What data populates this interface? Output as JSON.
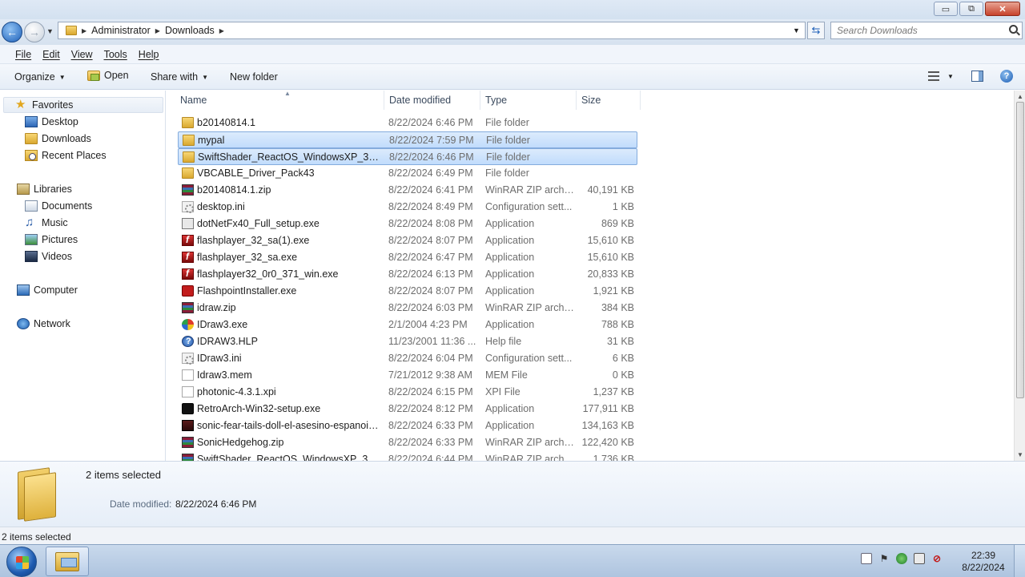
{
  "window": {
    "controls": {
      "minimize": "▭",
      "maximize": "⧉",
      "close": "✕"
    }
  },
  "address": {
    "crumbs": [
      "Administrator",
      "Downloads"
    ],
    "search_placeholder": "Search Downloads"
  },
  "menu": [
    "File",
    "Edit",
    "View",
    "Tools",
    "Help"
  ],
  "commands": {
    "organize": "Organize",
    "open": "Open",
    "share": "Share with",
    "new_folder": "New folder"
  },
  "nav": {
    "favorites": "Favorites",
    "favorites_items": [
      "Desktop",
      "Downloads",
      "Recent Places"
    ],
    "libraries": "Libraries",
    "libraries_items": [
      "Documents",
      "Music",
      "Pictures",
      "Videos"
    ],
    "computer": "Computer",
    "network": "Network"
  },
  "columns": {
    "name": "Name",
    "date": "Date modified",
    "type": "Type",
    "size": "Size"
  },
  "files": [
    {
      "name": "b20140814.1",
      "date": "8/22/2024 6:46 PM",
      "type": "File folder",
      "size": "",
      "icon": "folder-icon",
      "selected": false
    },
    {
      "name": "mypal",
      "date": "8/22/2024 7:59 PM",
      "type": "File folder",
      "size": "",
      "icon": "folder-icon",
      "selected": true
    },
    {
      "name": "SwiftShader_ReactOS_WindowsXP_3.2.10....",
      "date": "8/22/2024 6:46 PM",
      "type": "File folder",
      "size": "",
      "icon": "folder-icon",
      "selected": true
    },
    {
      "name": "VBCABLE_Driver_Pack43",
      "date": "8/22/2024 6:49 PM",
      "type": "File folder",
      "size": "",
      "icon": "folder-icon",
      "selected": false
    },
    {
      "name": "b20140814.1.zip",
      "date": "8/22/2024 6:41 PM",
      "type": "WinRAR ZIP archive",
      "size": "40,191 KB",
      "icon": "zip-icon",
      "selected": false
    },
    {
      "name": "desktop.ini",
      "date": "8/22/2024 8:49 PM",
      "type": "Configuration sett...",
      "size": "1 KB",
      "icon": "ini-icon",
      "selected": false
    },
    {
      "name": "dotNetFx40_Full_setup.exe",
      "date": "8/22/2024 8:08 PM",
      "type": "Application",
      "size": "869 KB",
      "icon": "exe-icon",
      "selected": false
    },
    {
      "name": "flashplayer_32_sa(1).exe",
      "date": "8/22/2024 8:07 PM",
      "type": "Application",
      "size": "15,610 KB",
      "icon": "flash-icon",
      "selected": false
    },
    {
      "name": "flashplayer_32_sa.exe",
      "date": "8/22/2024 6:47 PM",
      "type": "Application",
      "size": "15,610 KB",
      "icon": "flash-icon",
      "selected": false
    },
    {
      "name": "flashplayer32_0r0_371_win.exe",
      "date": "8/22/2024 6:13 PM",
      "type": "Application",
      "size": "20,833 KB",
      "icon": "flash-icon",
      "selected": false
    },
    {
      "name": "FlashpointInstaller.exe",
      "date": "8/22/2024 8:07 PM",
      "type": "Application",
      "size": "1,921 KB",
      "icon": "flashpoint-icon",
      "selected": false
    },
    {
      "name": "idraw.zip",
      "date": "8/22/2024 6:03 PM",
      "type": "WinRAR ZIP archive",
      "size": "384 KB",
      "icon": "zip-icon",
      "selected": false
    },
    {
      "name": "IDraw3.exe",
      "date": "2/1/2004 4:23 PM",
      "type": "Application",
      "size": "788 KB",
      "icon": "idraw-icon",
      "selected": false
    },
    {
      "name": "IDRAW3.HLP",
      "date": "11/23/2001 11:36 ...",
      "type": "Help file",
      "size": "31 KB",
      "icon": "help-file-icon",
      "selected": false
    },
    {
      "name": "IDraw3.ini",
      "date": "8/22/2024 6:04 PM",
      "type": "Configuration sett...",
      "size": "6 KB",
      "icon": "ini-icon",
      "selected": false
    },
    {
      "name": "Idraw3.mem",
      "date": "7/21/2012 9:38 AM",
      "type": "MEM File",
      "size": "0 KB",
      "icon": "blank-file-icon",
      "selected": false
    },
    {
      "name": "photonic-4.3.1.xpi",
      "date": "8/22/2024 6:15 PM",
      "type": "XPI File",
      "size": "1,237 KB",
      "icon": "blank-file-icon",
      "selected": false
    },
    {
      "name": "RetroArch-Win32-setup.exe",
      "date": "8/22/2024 8:12 PM",
      "type": "Application",
      "size": "177,911 KB",
      "icon": "retroarch-icon",
      "selected": false
    },
    {
      "name": "sonic-fear-tails-doll-el-asesino-espanoi.e...",
      "date": "8/22/2024 6:33 PM",
      "type": "Application",
      "size": "134,163 KB",
      "icon": "sonic-icon",
      "selected": false
    },
    {
      "name": "SonicHedgehog.zip",
      "date": "8/22/2024 6:33 PM",
      "type": "WinRAR ZIP archive",
      "size": "122,420 KB",
      "icon": "zip-icon",
      "selected": false
    },
    {
      "name": "SwiftShader_ReactOS_WindowsXP_3.2.10....",
      "date": "8/22/2024 6:44 PM",
      "type": "WinRAR ZIP archive",
      "size": "1,736 KB",
      "icon": "zip-icon",
      "selected": false
    }
  ],
  "details": {
    "count": "2 items selected",
    "date_label": "Date modified:",
    "date_value": "8/22/2024 6:46 PM"
  },
  "status": "2 items selected",
  "taskbar": {
    "time": "22:39",
    "date": "8/22/2024"
  },
  "colors": {
    "selection": "#c1dcfc",
    "selection_border": "#84acdd",
    "accent": "#1d5fb8"
  }
}
